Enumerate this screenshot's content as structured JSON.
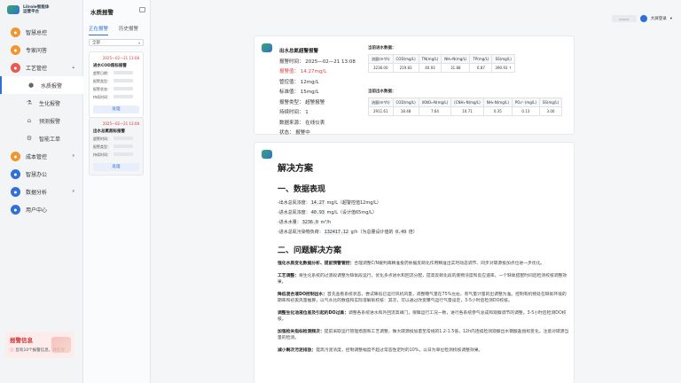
{
  "app": {
    "logo_line1": "Lilrole智能体",
    "logo_line2": "运营平台"
  },
  "nav": [
    {
      "label": "智慧总控",
      "icon": "dashboard-icon",
      "color": "#f0962f"
    },
    {
      "label": "专家问答",
      "icon": "chat-icon",
      "color": "#f0962f"
    },
    {
      "label": "工艺管控",
      "icon": "process-icon",
      "color": "#e85a4f",
      "expanded": true
    }
  ],
  "subnav": [
    {
      "label": "水质报警",
      "icon": "water-drop-icon",
      "active": true
    },
    {
      "label": "生化报警",
      "icon": "flask-icon"
    },
    {
      "label": "预测报警",
      "icon": "forecast-icon"
    },
    {
      "label": "智能工单",
      "icon": "gear-icon"
    }
  ],
  "nav2": [
    {
      "label": "成本管控",
      "icon": "cost-icon",
      "color": "#f0962f"
    },
    {
      "label": "智慧办公",
      "icon": "office-icon",
      "color": "#2f6fd6"
    },
    {
      "label": "数据分析",
      "icon": "analytics-icon",
      "color": "#2f6fd6"
    },
    {
      "label": "用户中心",
      "icon": "user-icon",
      "color": "#2f6fd6"
    }
  ],
  "alert_box": {
    "title": "报警信息",
    "text": "您有10个报警信息，请处理"
  },
  "panel": {
    "title": "水质报警",
    "tabs": [
      "正在报警",
      "历史报警"
    ],
    "filter": "全部",
    "cards": [
      {
        "ts": "2025—02—21 13:08",
        "title": "进水COD超标报警",
        "rows": [
          "超警日期：",
          "报警类型：",
          "报警状态：",
          "持续时间："
        ],
        "btn": "处理"
      },
      {
        "ts": "2025—02—21 13:08",
        "title": "出水总氮超标报警",
        "rows": [
          "超警时间：",
          "报警类型：",
          "持续时间："
        ],
        "btn": "处理"
      }
    ]
  },
  "topbar": {
    "user": "大屏登录"
  },
  "info": {
    "title": "出水总氮超警报警",
    "rows": [
      {
        "text": "报警时间：  2025—02—21 13:08",
        "red": false
      },
      {
        "text": "报警值：  14.27mg/L",
        "red": true
      },
      {
        "text": "管控值：  12mg/L",
        "red": false
      },
      {
        "text": "标准值：  15mg/L",
        "red": false
      },
      {
        "text": "报警类型：  超警报警",
        "red": false
      },
      {
        "text": "持续时间：  1",
        "red": false
      },
      {
        "text": "数据来源：  在线仪表",
        "red": false
      },
      {
        "text": "状态：  报警中",
        "red": false
      }
    ]
  },
  "table1": {
    "title": "当前进水数据：",
    "headers": [
      "流量(m³/h)",
      "COD(mg/L)",
      "TN(mg/L)",
      "NH₃-N(mg/L)",
      "TP(mg/L)",
      "SS(mg/L)"
    ],
    "values": [
      "3236.00",
      "219.83",
      "40.93",
      "31.88",
      "6.87",
      "390.93 ↑"
    ]
  },
  "table2": {
    "title": "当前出水数据：",
    "headers": [
      "流量(m³/h)",
      "COD(mg/L)",
      "(KNO₃-N(mg/L)",
      "(CNH₃-N(mg/L)",
      "NH₃-N(mg/L)",
      "PO₄³⁻(mg/L)",
      "SS(mg/L)"
    ],
    "values": [
      "2911.61",
      "18.48",
      "7.64",
      "10.71",
      "0.35",
      "0.13",
      "3.00"
    ]
  },
  "solution": {
    "title": "解决方案",
    "h_data": "一、数据表现",
    "items": [
      {
        "label": "-出水总氮浓度：",
        "code": "14.27",
        "rest": " mg/L（超警控值12mg/L）"
      },
      {
        "label": "-进水总氮浓度：",
        "code": "40.93",
        "rest": " mg/L（设计值65mg/L）"
      },
      {
        "label": "-进水水量：",
        "code": "3236.0",
        "rest": " m³/h"
      },
      {
        "label": "-进水总氮污染物负荷：",
        "code": "132417.12",
        "rest": " g/h（为总量设计值的 ",
        "code2": "0.49",
        "rest2": " 倍）"
      }
    ],
    "h_problem": "二、问题解决方案",
    "paras": [
      {
        "b": "强化水质变化数据分析、提前预警管控：",
        "t": "合理调整C/N缓判再精准投药依据反硝化作用精准出实时动态调节、同步对碳源投加点位进一步优化。"
      },
      {
        "b": "工艺调整：",
        "t": "将生化系统的过渡段调整为缺氧段运行，优化多点进水和回流分配，提高反硝化段的底物浓度和反应速率。一个缺氧搭配时间后检测校核调整效果。"
      },
      {
        "b": "降低混合液DO控制出水：",
        "t": "首先查看系统状态，尝试降低已运行风机风量，调整曝气量在75%左右，有气量计量的出调整为准。控制有机物处在缺氧环境的期率和初衷风量推算，以气水比的数值和实际溶解氧校核：其次，可以通过改变曝气运行气量设定，3-5小时后检测DO校核。"
      },
      {
        "b": "调整生化池液位差及引起的DO过高：",
        "t": "调整各系统进水和外回流高阀门，保障运行工况一致，进行各系统参气总成和观察调节的调整。3-5小时后检测DO校核。"
      },
      {
        "b": "加强检关指标检测频次：",
        "t": "提前采取运行管理措施和工艺调整，做大碳源投加量至常规的1.2-1.5倍，12h内连续检测观察出水钢酸盐指标变化，注意对碳源当量的检测。"
      },
      {
        "b": "减小剩次污泥排放：",
        "t": "提高污泥浓度，控制调整幅度不超过常态性定时的10%，以日为单位检测校核调整效果。"
      }
    ]
  }
}
